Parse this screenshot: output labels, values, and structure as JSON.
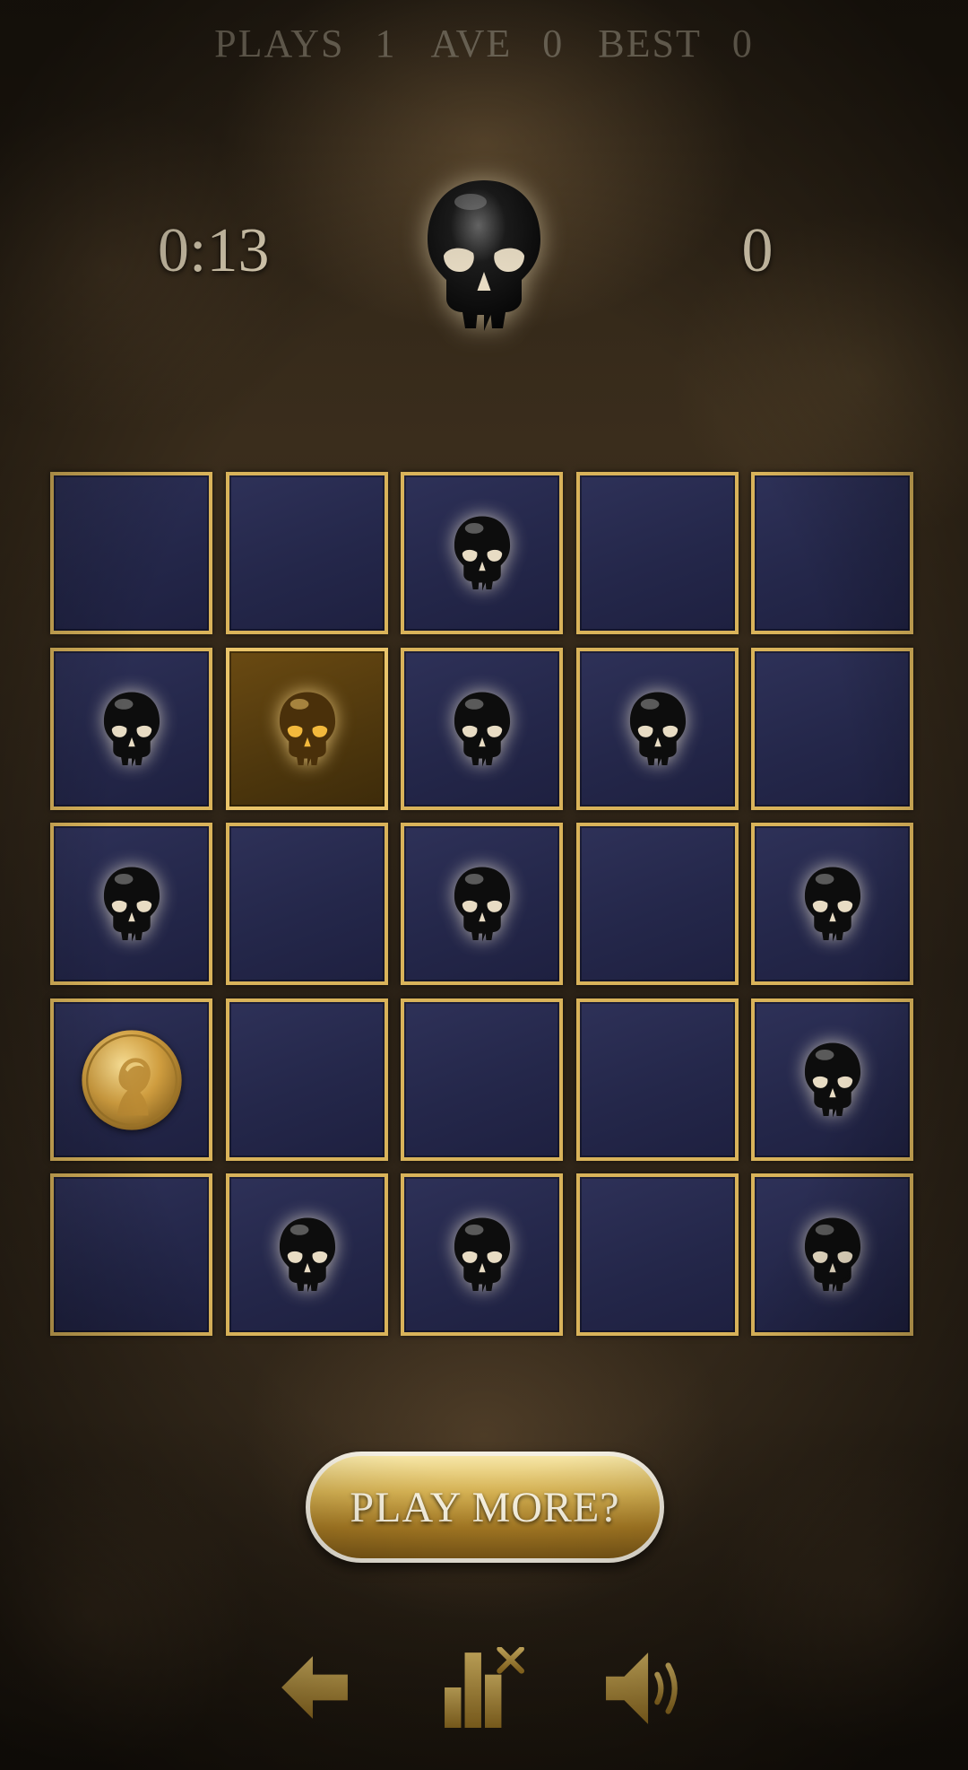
{
  "stats": {
    "plays_label": "PLAYS",
    "plays_value": "1",
    "ave_label": "AVE",
    "ave_value": "0",
    "best_label": "BEST",
    "best_value": "0"
  },
  "timer": "0:13",
  "score": "0",
  "board": {
    "rows": 5,
    "cols": 5,
    "cells": [
      [
        "empty",
        "empty",
        "skull",
        "empty",
        "empty"
      ],
      [
        "skull",
        "skull-active",
        "skull",
        "skull",
        "empty"
      ],
      [
        "skull",
        "empty",
        "skull",
        "empty",
        "skull"
      ],
      [
        "coin",
        "empty",
        "empty",
        "empty",
        "skull"
      ],
      [
        "empty",
        "skull",
        "skull",
        "empty",
        "skull"
      ]
    ]
  },
  "play_more_label": "PLAY MORE?",
  "controls": {
    "back_icon": "arrow-left-icon",
    "stats_icon": "stats-reset-icon",
    "sound_icon": "speaker-icon"
  },
  "colors": {
    "tile_border": "#d9b35a",
    "tile_fill": "#2a2d52",
    "tile_active_fill": "#5a3f10",
    "gold": "#c9a13f"
  }
}
